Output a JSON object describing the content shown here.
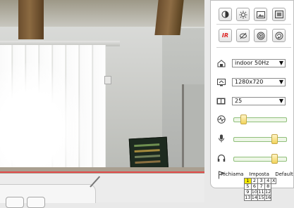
{
  "video": {
    "feed": "camera-live-view"
  },
  "panel": {
    "top_icons": [
      "brightness-icon",
      "exposure-icon",
      "image-icon",
      "display-icon"
    ],
    "second_icons": [
      "IR",
      "ir-off-icon",
      "target-icon",
      "rotate-icon"
    ],
    "select_rows": [
      {
        "icon": "environment-icon",
        "value": "indoor 50Hz"
      },
      {
        "icon": "resolution-icon",
        "value": "1280x720"
      },
      {
        "icon": "framerate-icon",
        "value": "25"
      }
    ],
    "slider_rows": [
      {
        "icon": "activity-icon",
        "level": 0.12
      },
      {
        "icon": "microphone-icon",
        "level": 0.78
      },
      {
        "icon": "headphones-icon",
        "level": 0.78
      }
    ],
    "preset": {
      "icon": "flag-icon",
      "labels": [
        "Richiama",
        "Imposta",
        "Default"
      ],
      "grid": [
        [
          "1",
          "2",
          "3",
          "4",
          "X"
        ],
        [
          "5",
          "6",
          "7",
          "8",
          ""
        ],
        [
          "9",
          "10",
          "11",
          "12",
          ""
        ],
        [
          "13",
          "14",
          "15",
          "16",
          ""
        ]
      ],
      "active": "1"
    }
  },
  "colors": {
    "active_cell": "#f1e600",
    "slider_border": "#8fbf7a"
  }
}
